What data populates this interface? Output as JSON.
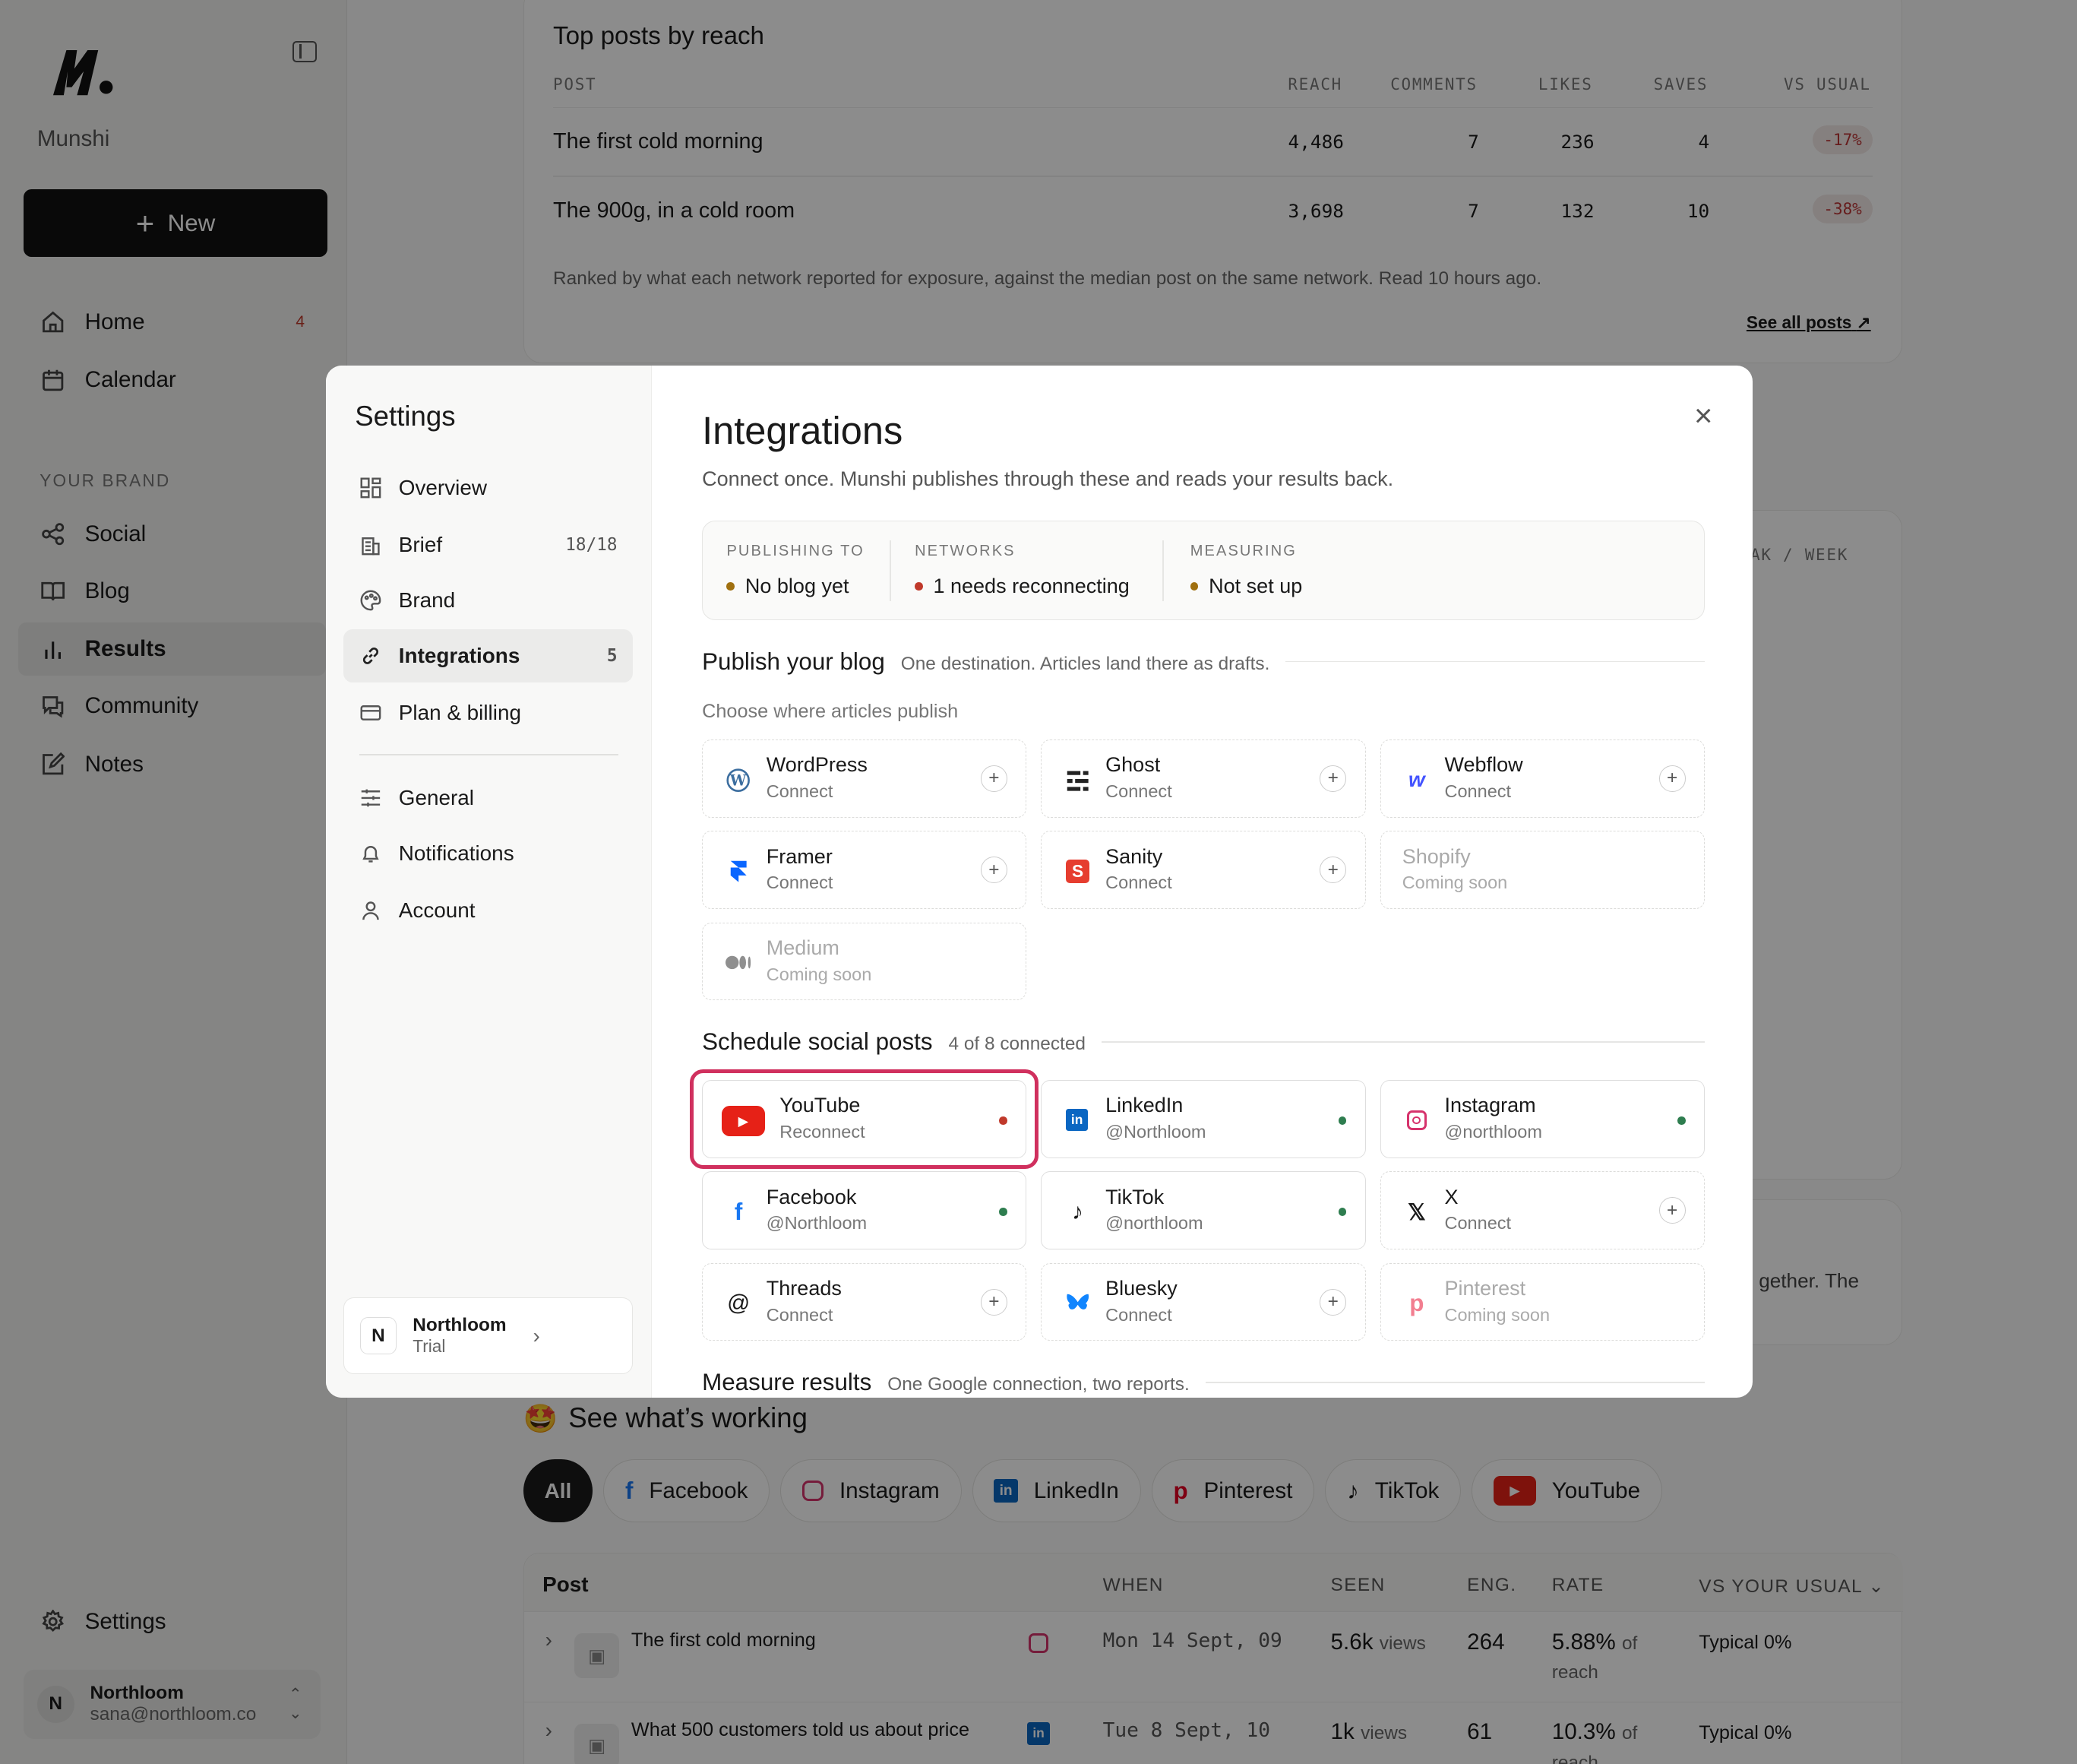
{
  "sidebar": {
    "brand": "Munshi",
    "new_label": "New",
    "items": [
      {
        "label": "Home",
        "badge": "4",
        "icon": "home-icon"
      },
      {
        "label": "Calendar",
        "icon": "calendar-icon"
      },
      {
        "label": "Social",
        "icon": "share-icon"
      },
      {
        "label": "Blog",
        "icon": "book-icon"
      },
      {
        "label": "Results",
        "icon": "bar-chart-icon"
      },
      {
        "label": "Community",
        "icon": "chat-icon"
      },
      {
        "label": "Notes",
        "icon": "edit-icon"
      }
    ],
    "section": "YOUR BRAND",
    "settings": "Settings",
    "user": {
      "initial": "N",
      "name": "Northloom",
      "email": "sana@northloom.co"
    }
  },
  "top_posts": {
    "title": "Top posts by reach",
    "headers": [
      "POST",
      "REACH",
      "COMMENTS",
      "LIKES",
      "SAVES",
      "VS USUAL"
    ],
    "rows": [
      {
        "post": "The first cold morning",
        "reach": "4,486",
        "comments": "7",
        "likes": "236",
        "saves": "4",
        "vs": "-17%"
      },
      {
        "post": "The 900g, in a cold room",
        "reach": "3,698",
        "comments": "7",
        "likes": "132",
        "saves": "10",
        "vs": "-38%"
      }
    ],
    "note": "Ranked by what each network reported for exposure, against the median post on the same network. Read 10 hours ago.",
    "see_all": "See all posts"
  },
  "behind": {
    "week_label": "AK / WEEK",
    "snippet": "gether. The"
  },
  "working": {
    "emoji": "🤩",
    "title": "See what’s working",
    "filters": [
      "All",
      "Facebook",
      "Instagram",
      "LinkedIn",
      "Pinterest",
      "TikTok",
      "YouTube"
    ],
    "headers": [
      "Post",
      "WHEN",
      "SEEN",
      "ENG.",
      "RATE",
      "VS YOUR USUAL"
    ],
    "rows": [
      {
        "post": "The first cold morning",
        "when": "Mon 14 Sept, 09",
        "seen": "5.6k",
        "seen_unit": "views",
        "eng": "264",
        "rate": "5.88%",
        "rate_unit": "of",
        "rate_unit2": "reach",
        "vs": "Typical 0%"
      },
      {
        "post": "What 500 customers told us about price",
        "when": "Tue 8 Sept, 10",
        "seen": "1k",
        "seen_unit": "views",
        "eng": "61",
        "rate": "10.3%",
        "rate_unit": "of",
        "rate_unit2": "reach",
        "vs": "Typical 0%"
      }
    ]
  },
  "settings": {
    "title": "Settings",
    "nav": [
      {
        "label": "Overview",
        "icon": "grid-icon"
      },
      {
        "label": "Brief",
        "count": "18/18",
        "icon": "building-icon"
      },
      {
        "label": "Brand",
        "icon": "palette-icon"
      },
      {
        "label": "Integrations",
        "count": "5",
        "icon": "link-icon"
      },
      {
        "label": "Plan & billing",
        "icon": "card-icon"
      },
      {
        "label": "General",
        "icon": "sliders-icon"
      },
      {
        "label": "Notifications",
        "icon": "bell-icon"
      },
      {
        "label": "Account",
        "icon": "user-icon"
      }
    ],
    "org": {
      "initial": "N",
      "name": "Northloom",
      "plan": "Trial"
    }
  },
  "integrations": {
    "title": "Integrations",
    "subtitle": "Connect once. Munshi publishes through these and reads your results back.",
    "status": [
      {
        "label": "PUBLISHING TO",
        "value": "No blog yet",
        "color": "#a07010"
      },
      {
        "label": "NETWORKS",
        "value": "1 needs reconnecting",
        "color": "#c0392b"
      },
      {
        "label": "MEASURING",
        "value": "Not set up",
        "color": "#a07010"
      }
    ],
    "blog": {
      "title": "Publish your blog",
      "hint": "One destination. Articles land there as drafts.",
      "choose": "Choose where articles publish",
      "tiles": [
        {
          "name": "WordPress",
          "status": "Connect"
        },
        {
          "name": "Ghost",
          "status": "Connect"
        },
        {
          "name": "Webflow",
          "status": "Connect"
        },
        {
          "name": "Framer",
          "status": "Connect"
        },
        {
          "name": "Sanity",
          "status": "Connect"
        },
        {
          "name": "Shopify",
          "status": "Coming soon"
        },
        {
          "name": "Medium",
          "status": "Coming soon"
        }
      ]
    },
    "social": {
      "title": "Schedule social posts",
      "hint": "4 of 8 connected",
      "tiles": [
        {
          "name": "YouTube",
          "status": "Reconnect",
          "dot": "#c0392b"
        },
        {
          "name": "LinkedIn",
          "status": "@Northloom",
          "dot": "#2e7d4f"
        },
        {
          "name": "Instagram",
          "status": "@northloom",
          "dot": "#2e7d4f"
        },
        {
          "name": "Facebook",
          "status": "@Northloom",
          "dot": "#2e7d4f"
        },
        {
          "name": "TikTok",
          "status": "@northloom",
          "dot": "#2e7d4f"
        },
        {
          "name": "X",
          "status": "Connect"
        },
        {
          "name": "Threads",
          "status": "Connect"
        },
        {
          "name": "Bluesky",
          "status": "Connect"
        },
        {
          "name": "Pinterest",
          "status": "Coming soon"
        }
      ]
    },
    "measure": {
      "title": "Measure results",
      "hint": "One Google connection, two reports."
    }
  }
}
